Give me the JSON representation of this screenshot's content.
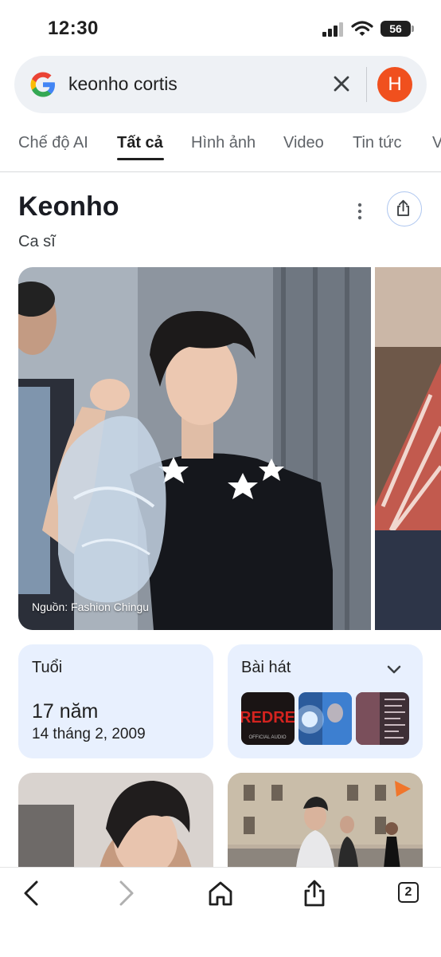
{
  "status_bar": {
    "time": "12:30",
    "battery": "56"
  },
  "search": {
    "query": "keonho cortis",
    "avatar_letter": "H"
  },
  "tabs": [
    {
      "label": "Chế độ AI"
    },
    {
      "label": "Tất cả",
      "active": true
    },
    {
      "label": "Hình ảnh"
    },
    {
      "label": "Video"
    },
    {
      "label": "Tin tức"
    },
    {
      "label": "V"
    }
  ],
  "entity": {
    "name": "Keonho",
    "description": "Ca sĩ"
  },
  "images": {
    "credit": "Nguồn: Fashion Chingu"
  },
  "age_card": {
    "label": "Tuổi",
    "age": "17 năm",
    "birthdate": "14 tháng 2, 2009"
  },
  "songs_card": {
    "label": "Bài hát",
    "thumb_text": "REDRE",
    "thumb_subtext": "OFFICIAL AUDIO"
  },
  "toolbar": {
    "tab_count": "2"
  },
  "colors": {
    "accent": "#1a73e8",
    "card_bg": "#e8f0fe",
    "avatar": "#f0501e"
  }
}
